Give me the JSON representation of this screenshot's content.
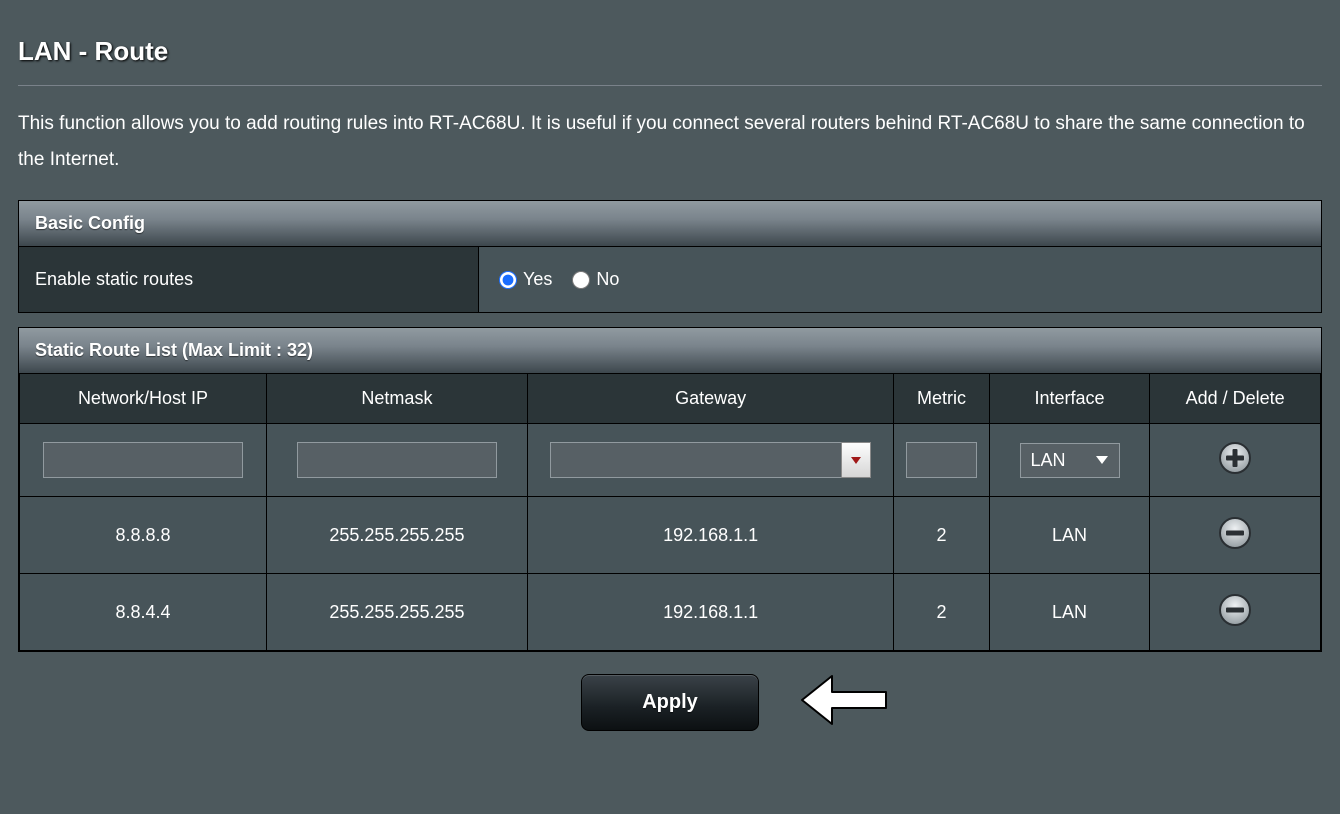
{
  "page": {
    "title": "LAN - Route",
    "description": "This function allows you to add routing rules into RT-AC68U. It is useful if you connect several routers behind RT-AC68U to share the same connection to the Internet."
  },
  "basic_config": {
    "header": "Basic Config",
    "enable_label": "Enable static routes",
    "yes_label": "Yes",
    "no_label": "No",
    "selected": "yes"
  },
  "route_list": {
    "header": "Static Route List (Max Limit : 32)",
    "columns": {
      "ip": "Network/Host IP",
      "netmask": "Netmask",
      "gateway": "Gateway",
      "metric": "Metric",
      "interface": "Interface",
      "action": "Add / Delete"
    },
    "new_row": {
      "ip": "",
      "netmask": "",
      "gateway": "",
      "metric": "",
      "interface": "LAN"
    },
    "rows": [
      {
        "ip": "8.8.8.8",
        "netmask": "255.255.255.255",
        "gateway": "192.168.1.1",
        "metric": "2",
        "interface": "LAN"
      },
      {
        "ip": "8.8.4.4",
        "netmask": "255.255.255.255",
        "gateway": "192.168.1.1",
        "metric": "2",
        "interface": "LAN"
      }
    ]
  },
  "footer": {
    "apply_label": "Apply"
  }
}
